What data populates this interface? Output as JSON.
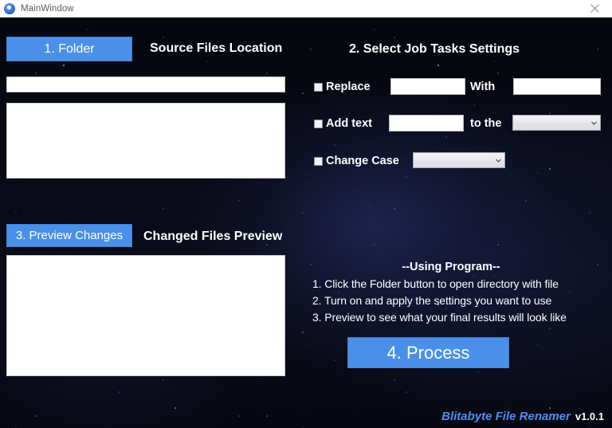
{
  "window": {
    "title": "MainWindow",
    "icon": "app-circle-icon",
    "close_label": "×"
  },
  "source_section": {
    "folder_button_label": "1. Folder",
    "heading": "Source Files Location",
    "path_value": "",
    "path_placeholder": "",
    "file_list_items": []
  },
  "tasks_section": {
    "heading": "2. Select Job Tasks Settings",
    "rows": [
      {
        "checkbox_label": "Replace",
        "checked": false,
        "input_value": "",
        "mid_label": "With",
        "second_input_value": ""
      },
      {
        "checkbox_label": "Add text",
        "checked": false,
        "input_value": "",
        "mid_label": "to the",
        "dropdown_value": "",
        "dropdown_options": []
      },
      {
        "checkbox_label": "Change Case",
        "checked": false,
        "dropdown_value": "",
        "dropdown_options": []
      }
    ]
  },
  "preview_section": {
    "preview_button_label": "3. Preview Changes",
    "heading": "Changed Files Preview",
    "preview_list_items": []
  },
  "help": {
    "title": "--Using Program--",
    "lines": [
      "1. Click the Folder button to open directory with file",
      "2. Turn on and apply the settings you want to use",
      "3. Preview to see what your final results will look like"
    ]
  },
  "process_button": {
    "label": "4. Process"
  },
  "footer": {
    "brand": "Blitabyte File Renamer",
    "version": "v1.0.1"
  },
  "colors": {
    "accent_blue": "#4a90e8",
    "brand_blue": "#4f8ef0",
    "background_dark": "#070812",
    "panel_white": "#ffffff"
  }
}
